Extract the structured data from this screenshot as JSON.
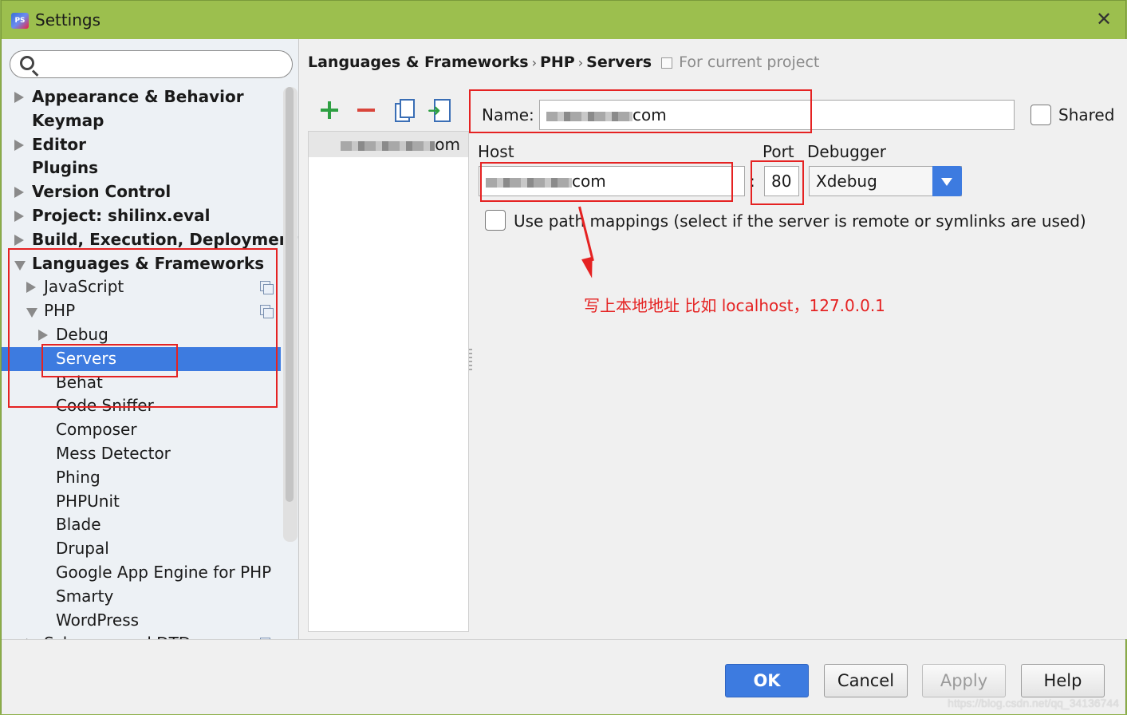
{
  "window": {
    "title": "Settings"
  },
  "search": {
    "placeholder": ""
  },
  "tree": [
    {
      "label": "Appearance & Behavior",
      "bold": true,
      "indent": 0,
      "arrow": "right"
    },
    {
      "label": "Keymap",
      "bold": true,
      "indent": 0,
      "arrow": "none"
    },
    {
      "label": "Editor",
      "bold": true,
      "indent": 0,
      "arrow": "right"
    },
    {
      "label": "Plugins",
      "bold": true,
      "indent": 0,
      "arrow": "none"
    },
    {
      "label": "Version Control",
      "bold": true,
      "indent": 0,
      "arrow": "right"
    },
    {
      "label": "Project: shilinx.eval",
      "bold": true,
      "indent": 0,
      "arrow": "right"
    },
    {
      "label": "Build, Execution, Deployment",
      "bold": true,
      "indent": 0,
      "arrow": "right"
    },
    {
      "label": "Languages & Frameworks",
      "bold": true,
      "indent": 0,
      "arrow": "down"
    },
    {
      "label": "JavaScript",
      "bold": false,
      "indent": 1,
      "arrow": "right",
      "project_icon": true
    },
    {
      "label": "PHP",
      "bold": false,
      "indent": 1,
      "arrow": "down",
      "project_icon": true
    },
    {
      "label": "Debug",
      "bold": false,
      "indent": 2,
      "arrow": "right"
    },
    {
      "label": "Servers",
      "bold": false,
      "indent": 2,
      "arrow": "none",
      "selected": true
    },
    {
      "label": "Behat",
      "bold": false,
      "indent": 2,
      "arrow": "none"
    },
    {
      "label": "Code Sniffer",
      "bold": false,
      "indent": 2,
      "arrow": "none"
    },
    {
      "label": "Composer",
      "bold": false,
      "indent": 2,
      "arrow": "none"
    },
    {
      "label": "Mess Detector",
      "bold": false,
      "indent": 2,
      "arrow": "none"
    },
    {
      "label": "Phing",
      "bold": false,
      "indent": 2,
      "arrow": "none"
    },
    {
      "label": "PHPUnit",
      "bold": false,
      "indent": 2,
      "arrow": "none"
    },
    {
      "label": "Blade",
      "bold": false,
      "indent": 2,
      "arrow": "none"
    },
    {
      "label": "Drupal",
      "bold": false,
      "indent": 2,
      "arrow": "none"
    },
    {
      "label": "Google App Engine for PHP",
      "bold": false,
      "indent": 2,
      "arrow": "none"
    },
    {
      "label": "Smarty",
      "bold": false,
      "indent": 2,
      "arrow": "none"
    },
    {
      "label": "WordPress",
      "bold": false,
      "indent": 2,
      "arrow": "none"
    },
    {
      "label": "Schemas and DTDs",
      "bold": false,
      "indent": 1,
      "arrow": "right",
      "project_icon": true
    }
  ],
  "breadcrumb": {
    "items": [
      "Languages & Frameworks",
      "PHP",
      "Servers"
    ],
    "separator": "›",
    "project_note": "For current project"
  },
  "server_list": {
    "items": [
      "om"
    ]
  },
  "form": {
    "name_label": "Name:",
    "name_value": "com",
    "shared_label": "Shared",
    "host_label": "Host",
    "host_value": "com",
    "port_separator": ":",
    "port_label": "Port",
    "port_value": "80",
    "debugger_label": "Debugger",
    "debugger_value": "Xdebug",
    "path_mappings_label": "Use path mappings (select if the server is remote or symlinks are used)"
  },
  "annotation": {
    "text": "写上本地地址 比如 localhost，127.0.0.1"
  },
  "buttons": {
    "ok": "OK",
    "cancel": "Cancel",
    "apply": "Apply",
    "help": "Help"
  },
  "watermark": "https://blog.csdn.net/qq_34136744",
  "colors": {
    "titlebar": "#9cbf4e",
    "selection": "#3d7be0",
    "annotation_red": "#e52222"
  }
}
